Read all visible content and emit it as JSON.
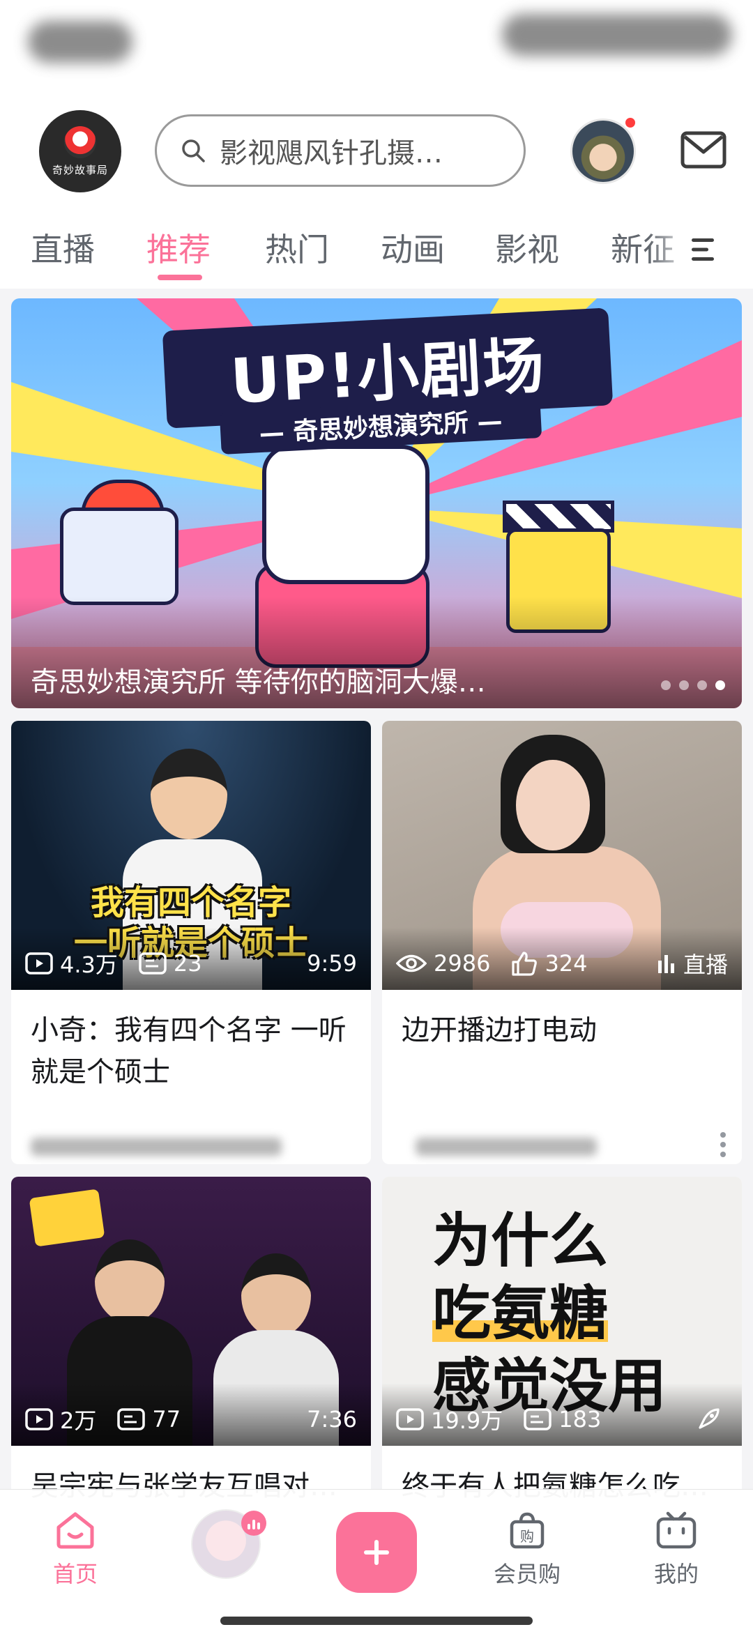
{
  "header": {
    "logo_text": "奇妙故事局",
    "search_placeholder": "影视飓风针孔摄…"
  },
  "tabs": [
    {
      "label": "直播",
      "active": false
    },
    {
      "label": "推荐",
      "active": true
    },
    {
      "label": "热门",
      "active": false
    },
    {
      "label": "动画",
      "active": false
    },
    {
      "label": "影视",
      "active": false
    },
    {
      "label": "新征",
      "active": false
    }
  ],
  "banner": {
    "title": "UP!小剧场",
    "subtitle": "— 奇思妙想演究所 —",
    "caption": "奇思妙想演究所  等待你的脑洞大爆…",
    "page_count": 4,
    "active_page": 4
  },
  "cards": [
    {
      "thumb_caption": "我有四个名字\n一听就是个硕士",
      "views": "4.3万",
      "danmaku": "23",
      "duration": "9:59",
      "title": "小奇：我有四个名字 一听就是个硕士"
    },
    {
      "views": "2986",
      "likes": "324",
      "live_label": "直播",
      "title": "边开播边打电动"
    },
    {
      "views": "2万",
      "danmaku": "77",
      "duration": "7:36",
      "title": "吴宗宪与张学友互唱对…"
    },
    {
      "thumb_caption": "为什么\n吃氨糖\n感觉没用",
      "views": "19.9万",
      "danmaku": "183",
      "title": "终于有人把氨糖怎么吃…"
    }
  ],
  "bottom_nav": {
    "home": "首页",
    "vip": "会员购",
    "mine": "我的"
  },
  "colors": {
    "accent": "#fb7299",
    "text_primary": "#18191c",
    "text_secondary": "#61666d"
  }
}
